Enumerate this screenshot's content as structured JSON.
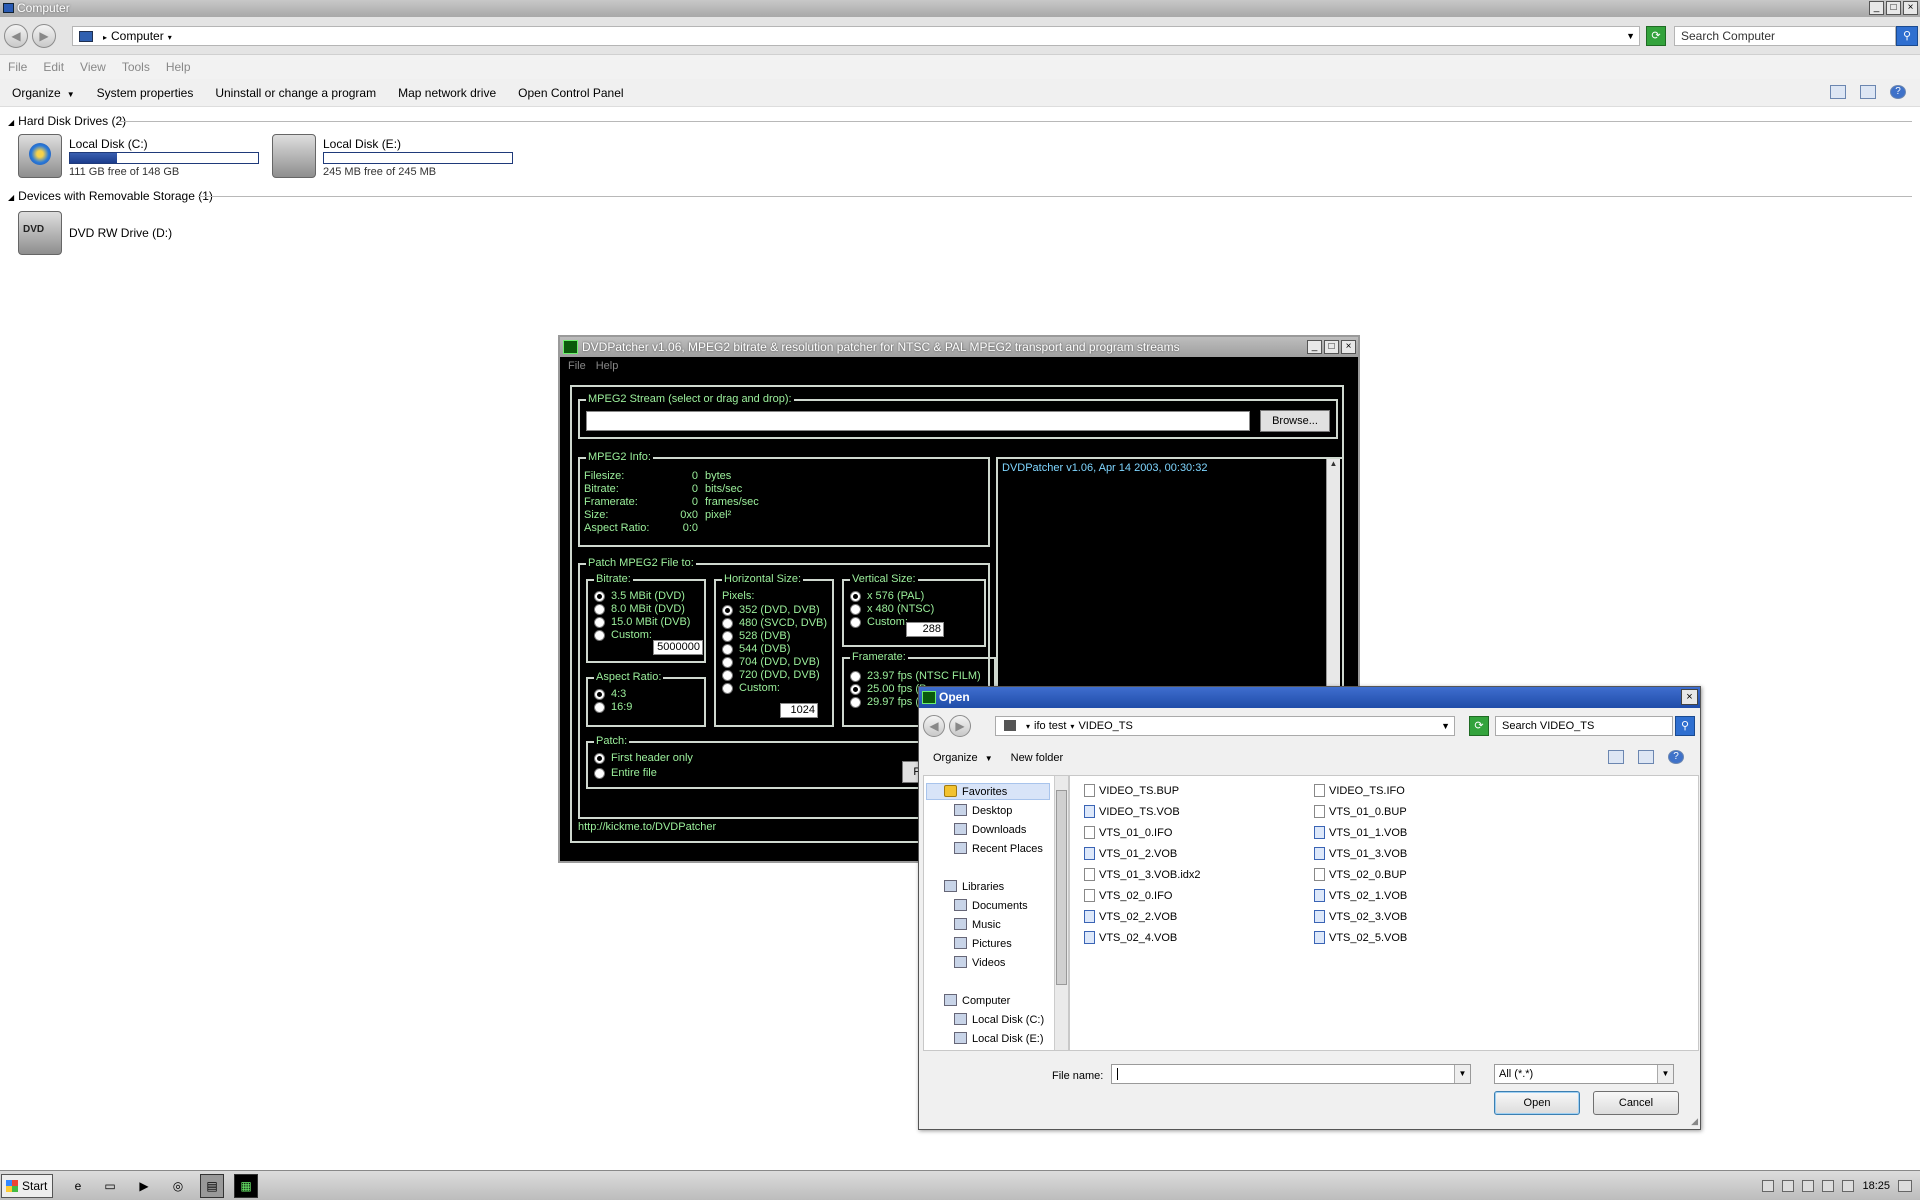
{
  "explorer": {
    "title": "Computer",
    "window_controls": [
      "_",
      "□",
      "×"
    ],
    "address": {
      "location": "Computer"
    },
    "search_placeholder": "Search Computer",
    "menu": [
      "File",
      "Edit",
      "View",
      "Tools",
      "Help"
    ],
    "toolbar": {
      "organize": "Organize",
      "system_properties": "System properties",
      "uninstall": "Uninstall or change a program",
      "map_drive": "Map network drive",
      "control_panel": "Open Control Panel"
    },
    "groups": {
      "hard_disk": "Hard Disk Drives (2)",
      "removable": "Devices with Removable Storage (1)"
    },
    "drives": [
      {
        "name": "Local Disk (C:)",
        "free": "111 GB free of 148 GB",
        "used_fraction": 0.25
      },
      {
        "name": "Local Disk (E:)",
        "free": "245 MB free of 245 MB",
        "used_fraction": 0.0
      },
      {
        "name": "DVD RW Drive (D:)"
      }
    ]
  },
  "dvdpatcher": {
    "title": "DVDPatcher v1.06, MPEG2 bitrate & resolution patcher for NTSC & PAL MPEG2 transport and program streams",
    "menu": [
      "File",
      "Help"
    ],
    "stream_label": "MPEG2 Stream (select or drag and drop):",
    "browse": "Browse...",
    "info_label": "MPEG2 Info:",
    "info": [
      {
        "name": "Filesize:",
        "value": "0",
        "unit": "bytes"
      },
      {
        "name": "Bitrate:",
        "value": "0",
        "unit": "bits/sec"
      },
      {
        "name": "Framerate:",
        "value": "0",
        "unit": "frames/sec"
      },
      {
        "name": "Size:",
        "value": "0x0",
        "unit": "pixel²"
      },
      {
        "name": "Aspect Ratio:",
        "value": "0:0",
        "unit": ""
      }
    ],
    "log": "DVDPatcher v1.06, Apr 14 2003, 00:30:32",
    "patch_label": "Patch MPEG2 File to:",
    "bitrate": {
      "label": "Bitrate:",
      "options": [
        "3.5 MBit (DVD)",
        "8.0 MBit (DVD)",
        "15.0 MBit (DVB)",
        "Custom:"
      ],
      "custom_value": "5000000"
    },
    "hsize": {
      "label": "Horizontal Size:",
      "sub": "Pixels:",
      "options": [
        "352 (DVD, DVB)",
        "480 (SVCD, DVB)",
        "528 (DVB)",
        "544 (DVB)",
        "704 (DVD, DVB)",
        "720 (DVD, DVB)",
        "Custom:"
      ],
      "custom_value": "1024"
    },
    "vsize": {
      "label": "Vertical Size:",
      "options": [
        "x 576 (PAL)",
        "x 480 (NTSC)",
        "Custom:"
      ],
      "custom_value": "288"
    },
    "framerate": {
      "label": "Framerate:",
      "options": [
        "23.97 fps (NTSC FILM)",
        "25.00 fps (P",
        "29.97 fps (N"
      ]
    },
    "aspect": {
      "label": "Aspect Ratio:",
      "options": [
        "4:3",
        "16:9"
      ]
    },
    "patch": {
      "label": "Patch:",
      "options": [
        "First header only",
        "Entire file"
      ],
      "button": "P"
    },
    "url": "http://kickme.to/DVDPatcher"
  },
  "open_dialog": {
    "title": "Open",
    "close": "×",
    "path": [
      "ifo test",
      "VIDEO_TS"
    ],
    "search_placeholder": "Search VIDEO_TS",
    "organize": "Organize",
    "new_folder": "New folder",
    "nav": {
      "favorites": "Favorites",
      "desktop": "Desktop",
      "downloads": "Downloads",
      "recent": "Recent Places",
      "libraries": "Libraries",
      "documents": "Documents",
      "music": "Music",
      "pictures": "Pictures",
      "videos": "Videos",
      "computer": "Computer",
      "disk_c": "Local Disk (C:)",
      "disk_e": "Local Disk (E:)"
    },
    "files_col1": [
      "VIDEO_TS.BUP",
      "VIDEO_TS.VOB",
      "VTS_01_0.IFO",
      "VTS_01_2.VOB",
      "VTS_01_3.VOB.idx2",
      "VTS_02_0.IFO",
      "VTS_02_2.VOB",
      "VTS_02_4.VOB"
    ],
    "files_col2": [
      "VIDEO_TS.IFO",
      "VTS_01_0.BUP",
      "VTS_01_1.VOB",
      "VTS_01_3.VOB",
      "VTS_02_0.BUP",
      "VTS_02_1.VOB",
      "VTS_02_3.VOB",
      "VTS_02_5.VOB"
    ],
    "filename_label": "File name:",
    "filename_value": "",
    "filter": "All (*.*)",
    "open_btn": "Open",
    "cancel_btn": "Cancel"
  },
  "taskbar": {
    "start": "Start",
    "clock": "18:25"
  }
}
